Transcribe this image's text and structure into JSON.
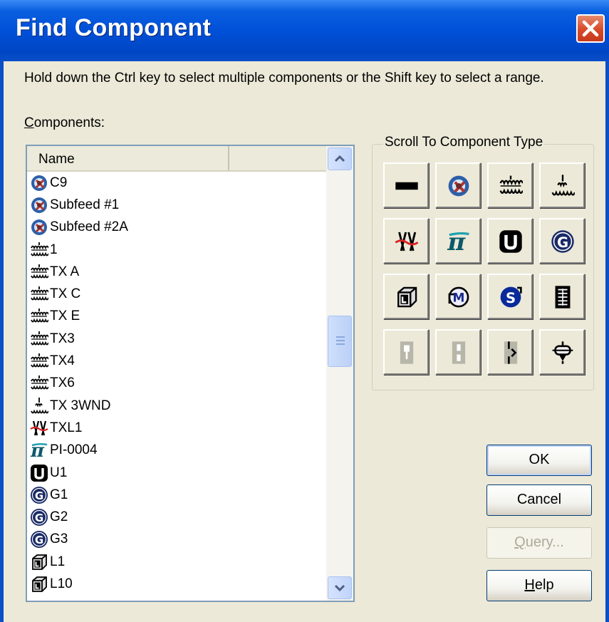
{
  "window": {
    "title": "Find Component",
    "close_icon": "close-icon"
  },
  "instructions": "Hold down the Ctrl key to select multiple components or the Shift key to select a range.",
  "components_label": {
    "mnemonic": "C",
    "rest": "omponents:"
  },
  "list": {
    "columns": [
      "Name",
      ""
    ],
    "items": [
      {
        "icon": "subfeed-icon",
        "label": "C9"
      },
      {
        "icon": "subfeed-icon",
        "label": "Subfeed #1"
      },
      {
        "icon": "subfeed-icon",
        "label": "Subfeed #2A"
      },
      {
        "icon": "transformer-icon",
        "label": "1"
      },
      {
        "icon": "transformer-icon",
        "label": "TX A"
      },
      {
        "icon": "transformer-icon",
        "label": "TX C"
      },
      {
        "icon": "transformer-icon",
        "label": "TX E"
      },
      {
        "icon": "transformer-icon",
        "label": "TX3"
      },
      {
        "icon": "transformer-icon",
        "label": "TX4"
      },
      {
        "icon": "transformer-icon",
        "label": "TX6"
      },
      {
        "icon": "three-winding-transformer-icon",
        "label": "TX 3WND"
      },
      {
        "icon": "transmission-line-icon",
        "label": "TXL1"
      },
      {
        "icon": "pi-section-icon",
        "label": "PI-0004"
      },
      {
        "icon": "utility-icon",
        "label": "U1"
      },
      {
        "icon": "generator-icon",
        "label": "G1"
      },
      {
        "icon": "generator-icon",
        "label": "G2"
      },
      {
        "icon": "generator-icon",
        "label": "G3"
      },
      {
        "icon": "load-icon",
        "label": "L1"
      },
      {
        "icon": "load-icon",
        "label": "L10"
      }
    ],
    "scroll_position": 0.41
  },
  "scroll_to_type": {
    "label": "Scroll To Component Type",
    "buttons": [
      {
        "icon": "bus-icon",
        "enabled": true
      },
      {
        "icon": "subfeed-icon",
        "enabled": true
      },
      {
        "icon": "transformer-icon",
        "enabled": true
      },
      {
        "icon": "three-winding-transformer-icon",
        "enabled": true
      },
      {
        "icon": "transmission-line-icon",
        "enabled": true
      },
      {
        "icon": "pi-section-icon",
        "enabled": true
      },
      {
        "icon": "utility-icon",
        "enabled": true
      },
      {
        "icon": "generator-icon",
        "enabled": true
      },
      {
        "icon": "load-icon",
        "enabled": true
      },
      {
        "icon": "motor-icon",
        "enabled": true
      },
      {
        "icon": "synchronous-motor-icon",
        "enabled": true
      },
      {
        "icon": "panel-icon",
        "enabled": true
      },
      {
        "icon": "fuse-icon",
        "enabled": false
      },
      {
        "icon": "switch-icon",
        "enabled": false
      },
      {
        "icon": "breaker-icon",
        "enabled": false
      },
      {
        "icon": "relay-icon",
        "enabled": true
      }
    ]
  },
  "buttons": {
    "ok": "OK",
    "cancel": "Cancel",
    "query": {
      "mnemonic": "Q",
      "rest": "uery...",
      "enabled": false
    },
    "help": {
      "mnemonic": "H",
      "rest": "elp"
    }
  }
}
